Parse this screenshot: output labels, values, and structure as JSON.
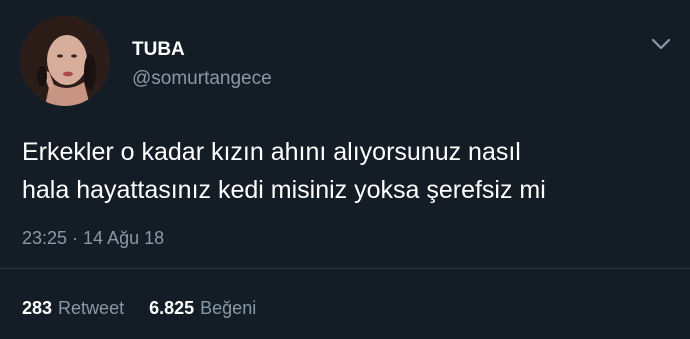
{
  "author": {
    "display_name": "TUBA",
    "handle": "@somurtangece",
    "avatar_icon": "profile-photo"
  },
  "menu": {
    "icon": "chevron-down-icon"
  },
  "tweet": {
    "lines": [
      "Erkekler o kadar kızın ahını alıyorsunuz nasıl",
      "hala hayattasınız kedi misiniz yoksa şerefsiz mi"
    ],
    "timestamp": "23:25 · 14 Ağu 18"
  },
  "stats": {
    "retweet_count": "283",
    "retweet_label": "Retweet",
    "like_count": "6.825",
    "like_label": "Beğeni"
  },
  "colors": {
    "background": "#141d26",
    "secondary_text": "#8899a6",
    "primary_text": "#ffffff"
  }
}
